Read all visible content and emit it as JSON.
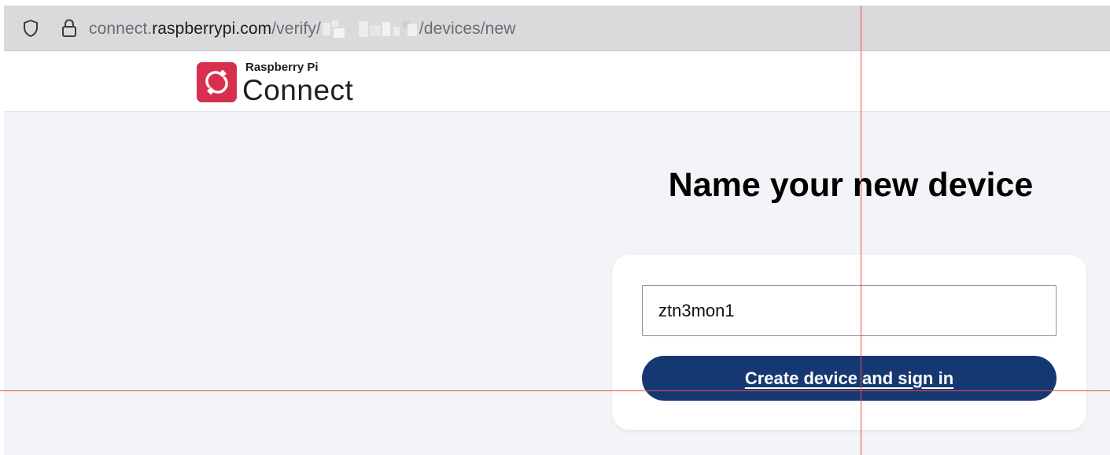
{
  "browser": {
    "url_prefix": "connect.",
    "url_domain": "raspberrypi.com",
    "url_path_start": "/verify/",
    "url_path_end": "/devices/new",
    "icons": {
      "tracking_protection": "shield-icon",
      "security": "lock-icon"
    }
  },
  "header": {
    "brand_small": "Raspberry Pi",
    "brand_large": "Connect",
    "logo_icon": "raspberry-pi-connect-logo-icon"
  },
  "main": {
    "title": "Name your new device",
    "device_name_value": "ztn3mon1",
    "submit_label": "Create device and sign in"
  },
  "colors": {
    "brand": "#d6304e",
    "button": "#163872",
    "background": "#f3f4f7",
    "guide": "#ef4b46"
  }
}
